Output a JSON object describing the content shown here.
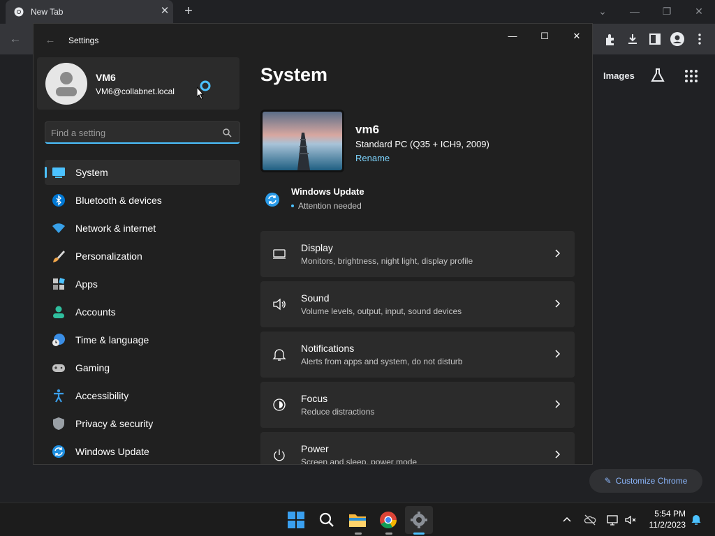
{
  "chrome": {
    "tab_title": "New Tab",
    "tab_close": "✕",
    "new_tab": "+",
    "images_label": "Images",
    "customize_label": "Customize Chrome"
  },
  "settings": {
    "window_title": "Settings",
    "user": {
      "name": "VM6",
      "email": "VM6@collabnet.local"
    },
    "search": {
      "placeholder": "Find a setting"
    },
    "nav": [
      {
        "label": "System",
        "icon": "system-icon",
        "active": true
      },
      {
        "label": "Bluetooth & devices",
        "icon": "bluetooth-icon"
      },
      {
        "label": "Network & internet",
        "icon": "wifi-icon"
      },
      {
        "label": "Personalization",
        "icon": "brush-icon"
      },
      {
        "label": "Apps",
        "icon": "apps-icon"
      },
      {
        "label": "Accounts",
        "icon": "accounts-icon"
      },
      {
        "label": "Time & language",
        "icon": "globe-clock-icon"
      },
      {
        "label": "Gaming",
        "icon": "gamepad-icon"
      },
      {
        "label": "Accessibility",
        "icon": "accessibility-icon"
      },
      {
        "label": "Privacy & security",
        "icon": "shield-icon"
      },
      {
        "label": "Windows Update",
        "icon": "update-icon"
      }
    ],
    "page_title": "System",
    "pc": {
      "name": "vm6",
      "model": "Standard PC (Q35 + ICH9, 2009)",
      "rename": "Rename"
    },
    "windows_update": {
      "title": "Windows Update",
      "status": "Attention needed"
    },
    "cards": [
      {
        "title": "Display",
        "subtitle": "Monitors, brightness, night light, display profile",
        "icon": "display-icon"
      },
      {
        "title": "Sound",
        "subtitle": "Volume levels, output, input, sound devices",
        "icon": "speaker-icon"
      },
      {
        "title": "Notifications",
        "subtitle": "Alerts from apps and system, do not disturb",
        "icon": "bell-icon"
      },
      {
        "title": "Focus",
        "subtitle": "Reduce distractions",
        "icon": "focus-icon"
      },
      {
        "title": "Power",
        "subtitle": "Screen and sleep, power mode",
        "icon": "power-icon"
      }
    ]
  },
  "taskbar": {
    "time": "5:54 PM",
    "date": "11/2/2023"
  },
  "colors": {
    "accent": "#4cc2ff",
    "window_bg": "#202020",
    "card_bg": "#2b2b2b"
  }
}
